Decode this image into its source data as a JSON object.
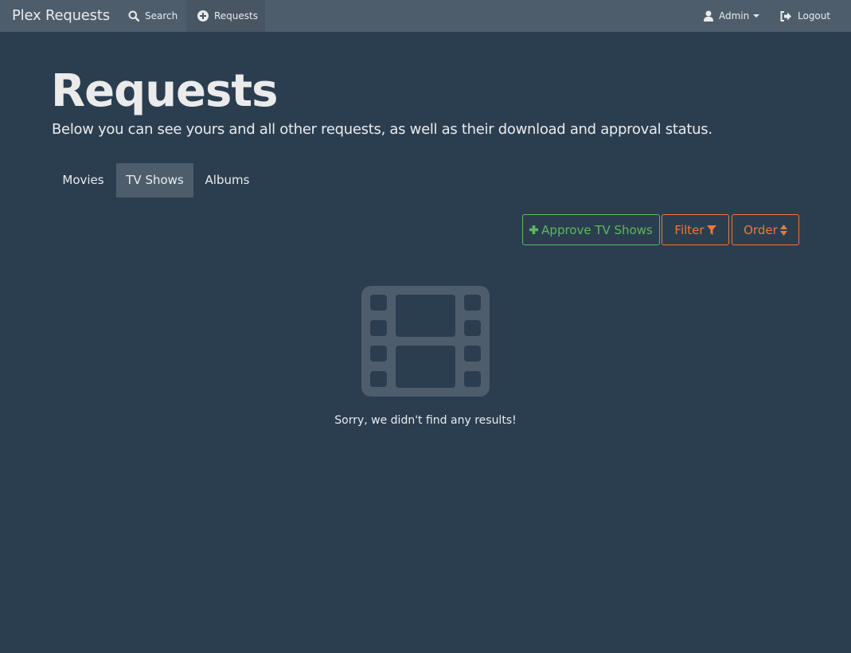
{
  "app": {
    "brand": "Plex Requests"
  },
  "nav": {
    "search_label": "Search",
    "requests_label": "Requests",
    "user_label": "Admin",
    "logout_label": "Logout"
  },
  "page": {
    "title": "Requests",
    "subtitle": "Below you can see yours and all other requests, as well as their download and approval status."
  },
  "tabs": [
    {
      "label": "Movies",
      "active": false
    },
    {
      "label": "TV Shows",
      "active": true
    },
    {
      "label": "Albums",
      "active": false
    }
  ],
  "actions": {
    "approve_label": "Approve TV Shows",
    "filter_label": "Filter",
    "order_label": "Order"
  },
  "empty_state": {
    "icon": "film-icon",
    "message": "Sorry, we didn't find any results!"
  },
  "colors": {
    "background": "#2b3e50",
    "navbar": "#4e5d6c",
    "success": "#5cb85c",
    "warning": "#f0763a",
    "muted_icon": "#4e5d6c"
  }
}
